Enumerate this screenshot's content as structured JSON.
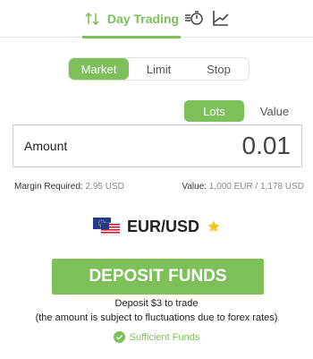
{
  "tabs": {
    "day_trading_label": "Day Trading",
    "accent": "#7dc05a"
  },
  "order_types": {
    "items": [
      "Market",
      "Limit",
      "Stop"
    ],
    "selected": "Market"
  },
  "amount_mode": {
    "lots_label": "Lots",
    "value_label": "Value",
    "selected": "Lots"
  },
  "amount": {
    "label": "Amount",
    "value": "0.01"
  },
  "margin": {
    "label": "Margin Required:",
    "value": "2.95 USD"
  },
  "trade_value": {
    "label": "Value:",
    "value": "1,000 EUR / 1,178 USD"
  },
  "instrument": {
    "pair": "EUR/USD",
    "favorite": true
  },
  "deposit": {
    "button_label": "DEPOSIT FUNDS",
    "line1": "Deposit $3 to trade",
    "line2": "(the amount is subject to fluctuations due to forex rates)",
    "status": "Sufficient Funds"
  }
}
